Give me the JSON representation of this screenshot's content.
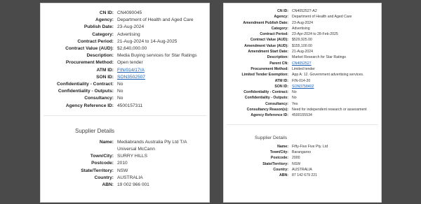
{
  "left": {
    "fields": [
      {
        "label": "CN ID:",
        "value": "CN4090045"
      },
      {
        "label": "Agency:",
        "value": "Department of Health and Aged Care"
      },
      {
        "label": "Publish Date:",
        "value": "23-Aug-2024"
      },
      {
        "label": "Category:",
        "value": "Advertising"
      },
      {
        "label": "Contract Period:",
        "value": "21-Aug-2024 to 14-Aug-2025"
      },
      {
        "label": "Contract Value (AUD):",
        "value": "$2,640,000.00"
      },
      {
        "label": "Description:",
        "value": "Media Buying services for Star Ratings"
      },
      {
        "label": "Procurement Method:",
        "value": "Open tender"
      },
      {
        "label": "ATM ID:",
        "value": "FIN/014/17/A",
        "link": true
      },
      {
        "label": "SON ID:",
        "value": "SON3502507",
        "link": true
      },
      {
        "label": "Confidentiality - Contract:",
        "value": "No"
      },
      {
        "label": "Confidentiality - Outputs:",
        "value": "No"
      },
      {
        "label": "Consultancy:",
        "value": "No"
      },
      {
        "label": "Agency Reference ID:",
        "value": "4500157311"
      }
    ],
    "supplier_heading": "Supplier Details",
    "supplier": [
      {
        "label": "Name:",
        "value": "Mediabrands Australia Pty Ltd T/A Universal McCann"
      },
      {
        "label": "Town/City:",
        "value": "SURRY HILLS"
      },
      {
        "label": "Postcode:",
        "value": "2010"
      },
      {
        "label": "State/Territory:",
        "value": "NSW"
      },
      {
        "label": "Country:",
        "value": "AUSTRALIA"
      },
      {
        "label": "ABN:",
        "value": "19 002 966 001"
      }
    ]
  },
  "right": {
    "fields": [
      {
        "label": "CN ID:",
        "value": "CN4052527-A2"
      },
      {
        "label": "Agency:",
        "value": "Department of Health and Aged Care"
      },
      {
        "label": "Amendment Publish Date:",
        "value": "23-Aug-2024"
      },
      {
        "label": "Category:",
        "value": "Advertising"
      },
      {
        "label": "Contract Period:",
        "value": "23-Apr-2024 to 28-Feb-2025"
      },
      {
        "label": "Contract Value (AUD):",
        "value": "$529,925.00"
      },
      {
        "label": "Amendment Value (AUD):",
        "value": "$155,100.00"
      },
      {
        "label": "Amendment Start Date:",
        "value": "21-Aug-2024"
      },
      {
        "label": "Description:",
        "value": "Market Research for Star Ratings"
      },
      {
        "label": "Parent CN:",
        "value": "CN4052527",
        "link": true
      },
      {
        "label": "Procurement Method:",
        "value": "Limited tender"
      },
      {
        "label": "Limited Tender Exemption:",
        "value": "App A: 12. Government advertising services."
      },
      {
        "label": "ATM ID:",
        "value": "FIN-014-20"
      },
      {
        "label": "SON ID:",
        "value": "SON3758402",
        "link": true
      },
      {
        "label": "Confidentiality - Contract:",
        "value": "No"
      },
      {
        "label": "Confidentiality - Outputs:",
        "value": "No"
      },
      {
        "label": "Consultancy:",
        "value": "Yes"
      },
      {
        "label": "Consultancy Reason(s):",
        "value": "Need for independent research or assessment"
      },
      {
        "label": "Agency Reference ID:",
        "value": "4500155534"
      }
    ],
    "supplier_heading": "Supplier Details",
    "supplier": [
      {
        "label": "Name:",
        "value": "Fifty-Five Five Pty. Ltd"
      },
      {
        "label": "Town/City:",
        "value": "Barangaroo"
      },
      {
        "label": "Postcode:",
        "value": "2000"
      },
      {
        "label": "State/Territory:",
        "value": "NSW"
      },
      {
        "label": "Country:",
        "value": "AUSTRALIA"
      },
      {
        "label": "ABN:",
        "value": "87 142 679 221"
      }
    ]
  }
}
